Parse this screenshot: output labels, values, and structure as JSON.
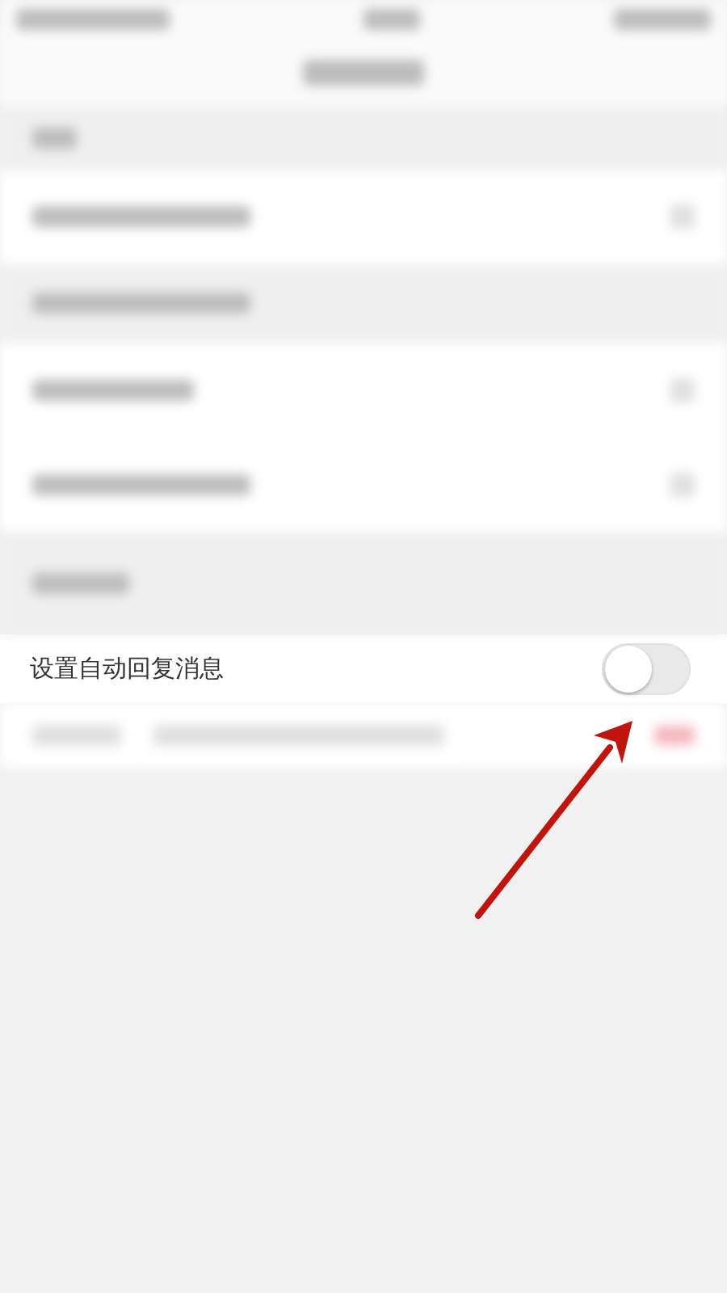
{
  "auto_reply": {
    "label": "设置自动回复消息",
    "on": false
  }
}
